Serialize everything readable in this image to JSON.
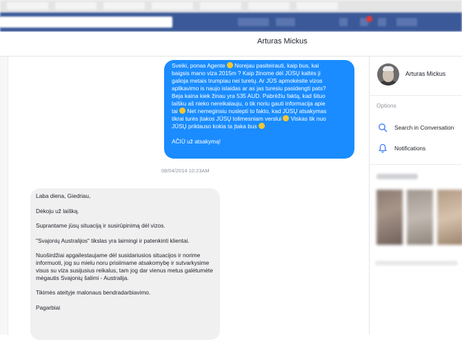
{
  "conversation": {
    "title": "Arturas Mickus"
  },
  "outgoing_message": {
    "lines": [
      "Sveiki, ponas Agente",
      " Norejau pasiteirauti, kaip bus, kai",
      "baigsis mano viza 2015m ? Kaip žinome dėl JŪSŲ kaltės ji",
      "galioja metais trumpiau nei turetų. Ar JŪS apmokėsite vizos",
      "aplikavimo is naujo islaidas ar as jas turesiu pasidengti pats?",
      "Beja kaina kiek žinau yra 535 AUD. Pabrėžiu faktą, kad šituo",
      "laišku aš nieko nereikalauju, o tik noriu gauti informacija apie",
      "tai",
      " Net nemeginsiu nuslepti to fakto, kad JŪSŲ atsakymas",
      "tikrai turės įtakos JŪSŲ tolimesniam verslui",
      " Viskas tik nuo",
      "JŪSŲ priklauso kokia ta įtaka bus",
      "AČIŪ už atsakymą!"
    ]
  },
  "timestamp": "08/04/2014 10:23AM",
  "incoming_message": {
    "paragraphs": [
      "Laba diena, Giedriau,",
      "Dėkoju už laišką.",
      "Suprantame jūsų situaciją ir susirūpinimą dėl vizos.",
      "\"Svajonių Australijos\" tikslas yra laimingi ir patenkinti klientai.",
      "Nuoširdžiai apgailestaujame dėl susidariusios situacijos ir norime informuoti, jog su mielu noru prisiimame atsakomybę ir sutvarkysime visus su viza susijusius reikalus, tam jog dar vienus metus galėtumėte mėgautis Svajonių šalimi - Australija.",
      "Tikimės ateityje malonaus bendradarbiavimo.",
      "Pagarbiai"
    ]
  },
  "right_panel": {
    "contact_name": "Arturas Mickus",
    "options_label": "Options",
    "search_label": "Search in Conversation",
    "notifications_label": "Notifications"
  },
  "colors": {
    "outgoing_bubble": "#1a8cff",
    "incoming_bubble": "#f1f0f0",
    "icon_blue": "#4080ff",
    "facebook_bar": "#3b5998"
  },
  "icons": [
    "search-icon",
    "bell-icon",
    "smiley-emoji"
  ]
}
